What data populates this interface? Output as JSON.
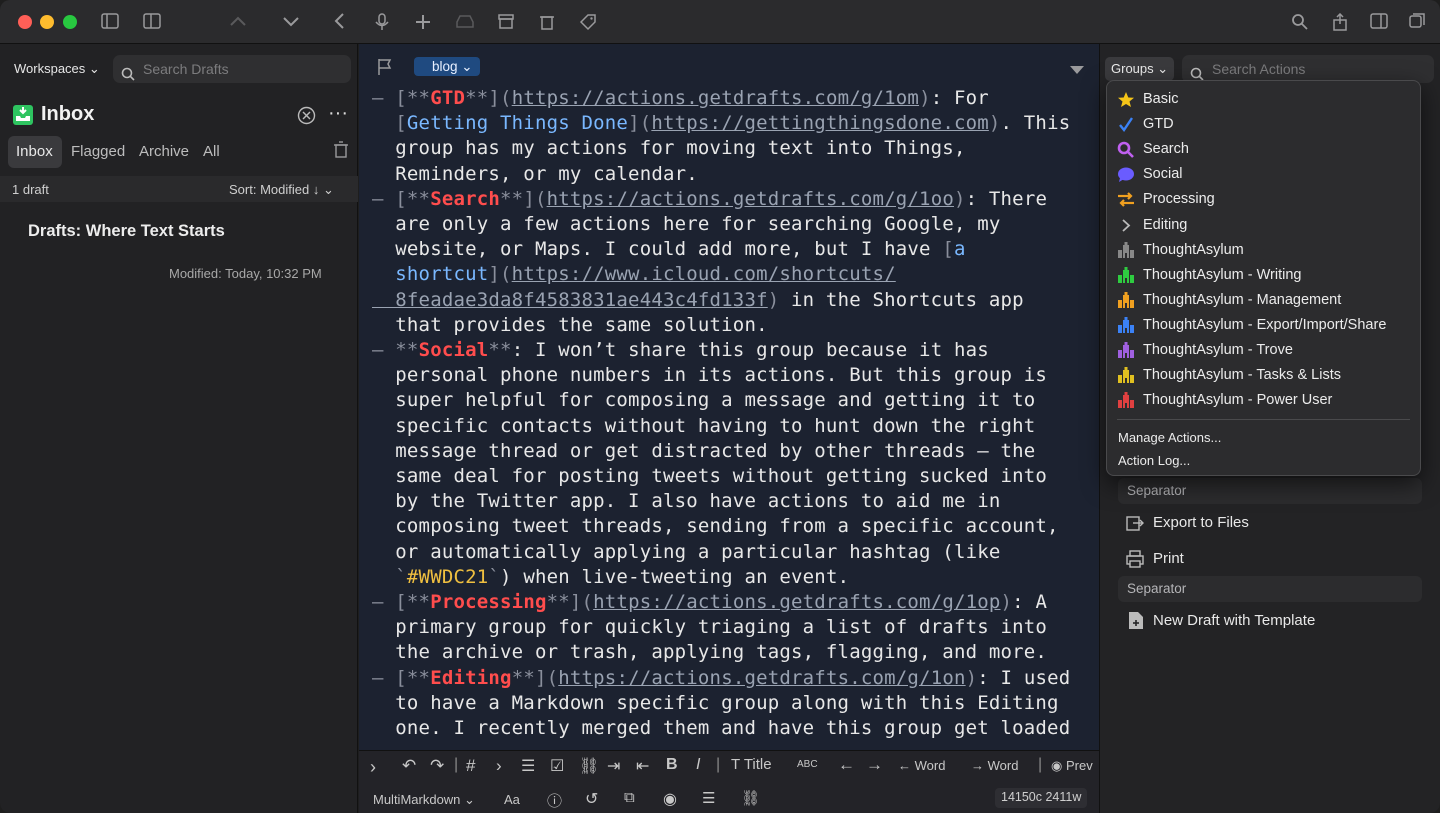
{
  "sidebar": {
    "workspaces_label": "Workspaces",
    "search_placeholder": "Search Drafts",
    "inbox_title": "Inbox",
    "tabs": [
      "Inbox",
      "Flagged",
      "Archive",
      "All"
    ],
    "count": "1 draft",
    "sort": "Sort: Modified ↓",
    "draft_title": "Drafts: Where Text Starts",
    "draft_modified": "Modified: Today, 10:32 PM"
  },
  "editor": {
    "tag": "blog",
    "lines": [
      [
        {
          "c": "dash",
          "t": "– "
        },
        {
          "c": "brk",
          "t": "[**"
        },
        {
          "c": "h",
          "t": "GTD"
        },
        {
          "c": "brk",
          "t": "**]("
        },
        {
          "c": "url",
          "t": "https://actions.getdrafts.com/g/1om"
        },
        {
          "c": "brk",
          "t": ")"
        },
        {
          "c": "",
          "t": ": For"
        }
      ],
      [
        {
          "c": "brk",
          "t": "  ["
        },
        {
          "c": "lnk",
          "t": "Getting Things Done"
        },
        {
          "c": "brk",
          "t": "]("
        },
        {
          "c": "url",
          "t": "https://gettingthingsdone.com"
        },
        {
          "c": "brk",
          "t": ")"
        },
        {
          "c": "",
          "t": ". This"
        }
      ],
      [
        {
          "c": "",
          "t": "  group has my actions for moving text into Things,"
        }
      ],
      [
        {
          "c": "",
          "t": "  Reminders, or my calendar."
        }
      ],
      [
        {
          "c": "dash",
          "t": "– "
        },
        {
          "c": "brk",
          "t": "[**"
        },
        {
          "c": "h",
          "t": "Search"
        },
        {
          "c": "brk",
          "t": "**]("
        },
        {
          "c": "url",
          "t": "https://actions.getdrafts.com/g/1oo"
        },
        {
          "c": "brk",
          "t": ")"
        },
        {
          "c": "",
          "t": ": There"
        }
      ],
      [
        {
          "c": "",
          "t": "  are only a few actions here for searching Google, my"
        }
      ],
      [
        {
          "c": "",
          "t": "  website, or Maps. I could add more, but I have "
        },
        {
          "c": "brk",
          "t": "["
        },
        {
          "c": "lnk",
          "t": "a"
        }
      ],
      [
        {
          "c": "lnk",
          "t": "  shortcut"
        },
        {
          "c": "brk",
          "t": "]("
        },
        {
          "c": "url",
          "t": "https://www.icloud.com/shortcuts/"
        }
      ],
      [
        {
          "c": "url",
          "t": "  8feadae3da8f4583831ae443c4fd133f"
        },
        {
          "c": "brk",
          "t": ")"
        },
        {
          "c": "",
          "t": " in the Shortcuts app"
        }
      ],
      [
        {
          "c": "",
          "t": "  that provides the same solution."
        }
      ],
      [
        {
          "c": "dash",
          "t": "– "
        },
        {
          "c": "brk",
          "t": "**"
        },
        {
          "c": "h",
          "t": "Social"
        },
        {
          "c": "brk",
          "t": "**"
        },
        {
          "c": "",
          "t": ": I won’t share this group because it has"
        }
      ],
      [
        {
          "c": "",
          "t": "  personal phone numbers in its actions. But this group is"
        }
      ],
      [
        {
          "c": "",
          "t": "  super helpful for composing a message and getting it to"
        }
      ],
      [
        {
          "c": "",
          "t": "  specific contacts without having to hunt down the right"
        }
      ],
      [
        {
          "c": "",
          "t": "  message thread or get distracted by other threads — the"
        }
      ],
      [
        {
          "c": "",
          "t": "  same deal for posting tweets without getting sucked into"
        }
      ],
      [
        {
          "c": "",
          "t": "  by the Twitter app. I also have actions to aid me in"
        }
      ],
      [
        {
          "c": "",
          "t": "  composing tweet threads, sending from a specific account,"
        }
      ],
      [
        {
          "c": "",
          "t": "  or automatically applying a particular hashtag (like"
        }
      ],
      [
        {
          "c": "brk",
          "t": "  `"
        },
        {
          "c": "code",
          "t": "#WWDC21"
        },
        {
          "c": "brk",
          "t": "`"
        },
        {
          "c": "",
          "t": ") when live-tweeting an event."
        }
      ],
      [
        {
          "c": "dash",
          "t": "– "
        },
        {
          "c": "brk",
          "t": "[**"
        },
        {
          "c": "h",
          "t": "Processing"
        },
        {
          "c": "brk",
          "t": "**]("
        },
        {
          "c": "url",
          "t": "https://actions.getdrafts.com/g/1op"
        },
        {
          "c": "brk",
          "t": ")"
        },
        {
          "c": "",
          "t": ": A"
        }
      ],
      [
        {
          "c": "",
          "t": "  primary group for quickly triaging a list of drafts into"
        }
      ],
      [
        {
          "c": "",
          "t": "  the archive or trash, applying tags, flagging, and more."
        }
      ],
      [
        {
          "c": "dash",
          "t": "– "
        },
        {
          "c": "brk",
          "t": "[**"
        },
        {
          "c": "h",
          "t": "Editing"
        },
        {
          "c": "brk",
          "t": "**]("
        },
        {
          "c": "url",
          "t": "https://actions.getdrafts.com/g/1on"
        },
        {
          "c": "brk",
          "t": ")"
        },
        {
          "c": "",
          "t": ": I used"
        }
      ],
      [
        {
          "c": "",
          "t": "  to have a Markdown specific group along with this Editing"
        }
      ],
      [
        {
          "c": "",
          "t": "  one. I recently merged them and have this group get loaded"
        }
      ]
    ]
  },
  "toolbar": {
    "title_btn": "Title",
    "abc_btn": "ABC",
    "word_left": "Word",
    "word_right": "Word",
    "preview": "Prev",
    "syntax": "MultiMarkdown",
    "aa": "Aa",
    "count": "14150c 2411w"
  },
  "actions": {
    "groups_label": "Groups",
    "search_placeholder": "Search Actions",
    "menu": [
      {
        "label": "Basic",
        "icon": "star-icon",
        "color": "#f5c518"
      },
      {
        "label": "GTD",
        "icon": "check-icon",
        "color": "#3b82f6"
      },
      {
        "label": "Search",
        "icon": "magnifier-icon",
        "color": "#c060f0"
      },
      {
        "label": "Social",
        "icon": "speech-bubble-icon",
        "color": "#6a5cff"
      },
      {
        "label": "Processing",
        "icon": "arrows-icon",
        "color": "#f0a020"
      },
      {
        "label": "Editing",
        "icon": "chevron-right-icon",
        "color": "#bbbbbb"
      },
      {
        "label": "ThoughtAsylum",
        "icon": "castle-icon",
        "color": "#888888"
      },
      {
        "label": "ThoughtAsylum - Writing",
        "icon": "castle-icon",
        "color": "#2ecc40"
      },
      {
        "label": "ThoughtAsylum - Management",
        "icon": "castle-icon",
        "color": "#f0a020"
      },
      {
        "label": "ThoughtAsylum - Export/Import/Share",
        "icon": "castle-icon",
        "color": "#3b82f6"
      },
      {
        "label": "ThoughtAsylum - Trove",
        "icon": "castle-icon",
        "color": "#a060e0"
      },
      {
        "label": "ThoughtAsylum - Tasks & Lists",
        "icon": "castle-icon",
        "color": "#e0c020"
      },
      {
        "label": "ThoughtAsylum - Power User",
        "icon": "castle-icon",
        "color": "#e04040"
      }
    ],
    "manage": "Manage Actions...",
    "log": "Action Log...",
    "separator1": "Separator",
    "export": "Export to Files",
    "print": "Print",
    "separator2": "Separator",
    "new_template": "New Draft with Template"
  }
}
